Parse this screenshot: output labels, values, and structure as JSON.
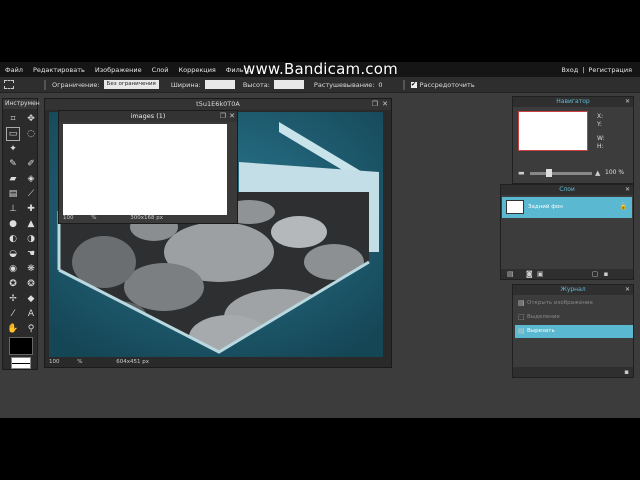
{
  "watermark": "www.Bandicam.com",
  "menu": {
    "items": [
      "Файл",
      "Редактировать",
      "Изображение",
      "Слой",
      "Коррекция",
      "Фильтр"
    ],
    "login": "Вход",
    "separator": "|",
    "register": "Регистрация"
  },
  "options": {
    "constraint_label": "Ограничение:",
    "constraint_value": "Без ограничения",
    "width_label": "Ширина:",
    "height_label": "Высота:",
    "feather_label": "Растушевывание:",
    "feather_value": "0",
    "antialias_label": "Рассредоточить",
    "antialias_check": "✔"
  },
  "tools": {
    "title": "Инструмен",
    "items": [
      {
        "name": "crop-icon",
        "glyph": "⌗"
      },
      {
        "name": "move-icon",
        "glyph": "✥"
      },
      {
        "name": "marquee-icon",
        "glyph": "▭"
      },
      {
        "name": "lasso-icon",
        "glyph": "◌"
      },
      {
        "name": "wand-icon",
        "glyph": "✦"
      },
      {
        "name": "blank-icon",
        "glyph": ""
      },
      {
        "name": "pencil-icon",
        "glyph": "✎"
      },
      {
        "name": "brush-icon",
        "glyph": "✐"
      },
      {
        "name": "eraser-icon",
        "glyph": "▰"
      },
      {
        "name": "bucket-icon",
        "glyph": "◈"
      },
      {
        "name": "gradient-icon",
        "glyph": "▤"
      },
      {
        "name": "picker-icon",
        "glyph": "⟋"
      },
      {
        "name": "stamp-icon",
        "glyph": "⊥"
      },
      {
        "name": "heal-icon",
        "glyph": "✚"
      },
      {
        "name": "blur-icon",
        "glyph": "●"
      },
      {
        "name": "sharpen-icon",
        "glyph": "▲"
      },
      {
        "name": "dodge-icon",
        "glyph": "◐"
      },
      {
        "name": "burn-icon",
        "glyph": "◑"
      },
      {
        "name": "sponge-icon",
        "glyph": "◒"
      },
      {
        "name": "smudge-icon",
        "glyph": "☚"
      },
      {
        "name": "redeye-icon",
        "glyph": "◉"
      },
      {
        "name": "liquify-icon",
        "glyph": "❋"
      },
      {
        "name": "spot-icon",
        "glyph": "✪"
      },
      {
        "name": "pinch-icon",
        "glyph": "❂"
      },
      {
        "name": "color-replace-icon",
        "glyph": "✢"
      },
      {
        "name": "shape-icon",
        "glyph": "◆"
      },
      {
        "name": "eyedropper-icon",
        "glyph": "⁄"
      },
      {
        "name": "type-icon",
        "glyph": "A"
      },
      {
        "name": "hand-icon",
        "glyph": "✋"
      },
      {
        "name": "zoom-icon",
        "glyph": "⚲"
      }
    ]
  },
  "document": {
    "title": "t5u1E6k0T0A",
    "zoom": "100",
    "zoom_unit": "%",
    "size": "604x451 px"
  },
  "image_window": {
    "title": "images (1)",
    "zoom": "100",
    "zoom_unit": "%",
    "size": "300x168 px"
  },
  "navigator": {
    "title": "Навигатор",
    "x_label": "X:",
    "y_label": "Y:",
    "w_label": "W:",
    "h_label": "H:",
    "zoom": "100",
    "zoom_unit": "%"
  },
  "layers": {
    "title": "Слои",
    "items": [
      {
        "name": "Задний фон",
        "locked": true
      }
    ]
  },
  "history": {
    "title": "Журнал",
    "items": [
      {
        "label": "Открыть изображение",
        "active": false
      },
      {
        "label": "Выделение",
        "active": false
      },
      {
        "label": "Вырезать",
        "active": true
      }
    ]
  },
  "colors": {
    "accent": "#5ab9d0",
    "panel_title": "#61b9d2",
    "canvas_bg": "#1f5a6e",
    "frame": "#b9d8e0"
  }
}
